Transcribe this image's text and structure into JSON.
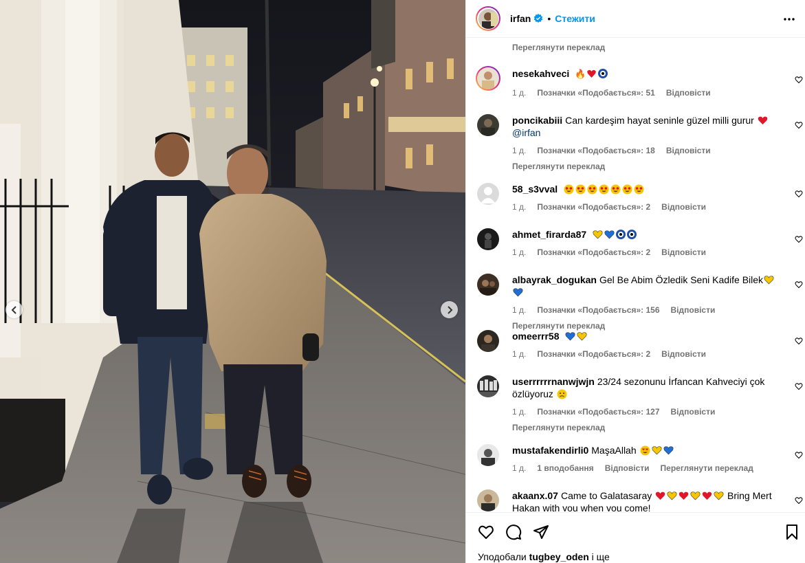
{
  "post": {
    "author": "irfan",
    "follow_label": "Стежити",
    "separator": "•"
  },
  "comments_top_translation": "Переглянути переклад",
  "comments": [
    {
      "user": "nesekahveci",
      "text": "",
      "time": "1 д.",
      "likes": "Позначки «Подобається»: 51",
      "reply": "Відповісти",
      "translation": ""
    },
    {
      "user": "poncikabiii",
      "text": "Can kardeşim hayat seninle güzel milli gurur",
      "mention": "@irfan",
      "time": "1 д.",
      "likes": "Позначки «Подобається»: 18",
      "reply": "Відповісти",
      "translation": "Переглянути переклад"
    },
    {
      "user": "58_s3vval",
      "text": "",
      "time": "1 д.",
      "likes": "Позначки «Подобається»: 2",
      "reply": "Відповісти",
      "translation": ""
    },
    {
      "user": "ahmet_firarda87",
      "text": "",
      "time": "1 д.",
      "likes": "Позначки «Подобається»: 2",
      "reply": "Відповісти",
      "translation": ""
    },
    {
      "user": "albayrak_dogukan",
      "text": "Gel Be Abim Özledik Seni Kadife Bilek",
      "time": "1 д.",
      "likes": "Позначки «Подобається»: 156",
      "reply": "Відповісти",
      "translation": "Переглянути переклад"
    },
    {
      "user": "omeerrr58",
      "text": "",
      "time": "1 д.",
      "likes": "Позначки «Подобається»: 2",
      "reply": "Відповісти",
      "translation": ""
    },
    {
      "user": "userrrrrrnanwjwjn",
      "text": "23/24 sezonunu İrfancan Kahveciyi çok özlüyoruz",
      "time": "1 д.",
      "likes": "Позначки «Подобається»: 127",
      "reply": "Відповісти",
      "translation": "Переглянути переклад"
    },
    {
      "user": "mustafakendirli0",
      "text": "MaşaAllah",
      "time": "1 д.",
      "likes": "1 вподобання",
      "reply": "Відповісти",
      "translation": "Переглянути переклад"
    },
    {
      "user": "akaanx.07",
      "text": "Came to Galatasaray",
      "text_tail": "Bring Mert Hakan with you when you come!",
      "time": "",
      "likes": "",
      "reply": "",
      "translation": ""
    }
  ],
  "footer": {
    "liked_prefix": "Уподобали",
    "liked_user": "tugbey_oden",
    "liked_suffix": "і ще"
  },
  "icons": {
    "like": "heart-outline-icon",
    "comment": "comment-bubble-icon",
    "share": "paper-plane-icon",
    "save": "bookmark-icon",
    "more": "more-dots-icon",
    "verified": "verified-badge-icon",
    "prev": "chevron-left-icon",
    "next": "chevron-right-icon"
  },
  "colors": {
    "accent": "#0095f6",
    "muted": "#737373",
    "mention": "#00376b",
    "heart_red": "#e0162b",
    "yellow": "#f7c600",
    "blue": "#1f6fd6"
  }
}
